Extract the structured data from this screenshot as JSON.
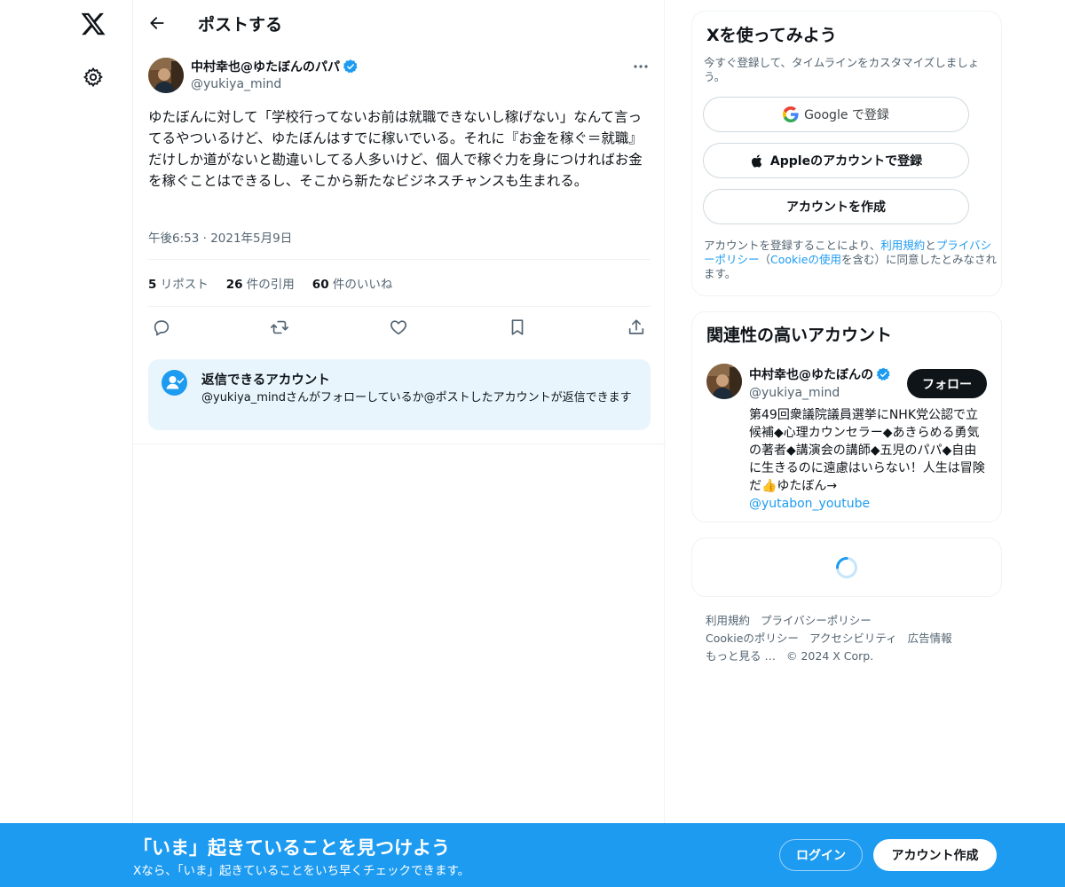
{
  "nav": {
    "logo_icon": "x-logo-icon",
    "settings_icon": "gear-icon"
  },
  "header": {
    "title": "ポストする"
  },
  "tweet": {
    "author_name": "中村幸也@ゆたぼんのパパ",
    "author_handle": "@yukiya_mind",
    "text": "ゆたぼんに対して「学校行ってないお前は就職できないし稼げない」なんて言ってるやついるけど、ゆたぼんはすでに稼いでいる。それに『お金を稼ぐ＝就職』だけしか道がないと勘違いしてる人多いけど、個人で稼ぐ力を身につければお金を稼ぐことはできるし、そこから新たなビジネスチャンスも生まれる。",
    "time": "午後6:53 · 2021年5月9日",
    "stats": {
      "reposts_count": "5",
      "reposts_label": "リポスト",
      "quotes_count": "26",
      "quotes_label": "件の引用",
      "likes_count": "60",
      "likes_label": "件のいいね"
    }
  },
  "reply_restriction": {
    "title": "返信できるアカウント",
    "description": "@yukiya_mindさんがフォローしているか@ポストしたアカウントが返信できます"
  },
  "signup": {
    "title": "Xを使ってみよう",
    "subtitle": "今すぐ登録して、タイムラインをカスタマイズしましょう。",
    "google_label": "Google で登録",
    "apple_label": "Appleのアカウントで登録",
    "create_label": "アカウントを作成",
    "terms_pre": "アカウントを登録することにより、",
    "terms_link1": "利用規約",
    "terms_mid1": "と",
    "terms_link2": "プライバシーポリシー",
    "terms_mid2": "（",
    "terms_link3": "Cookieの使用",
    "terms_post": "を含む）に同意したとみなされます。"
  },
  "related": {
    "title": "関連性の高いアカウント",
    "name": "中村幸也@ゆたぼんのパパ",
    "handle": "@yukiya_mind",
    "follow_label": "フォロー",
    "bio": "第49回衆議院議員選挙にNHK党公認で立候補◆心理カウンセラー◆あきらめる勇気の著者◆講演会の講師◆五児のパパ◆自由に生きるのに遠慮はいらない！人生は冒険だ👍ゆたぼん→",
    "bio_link": "@yutabon_youtube"
  },
  "footer": {
    "links": [
      "利用規約",
      "プライバシーポリシー",
      "Cookieのポリシー",
      "アクセシビリティ",
      "広告情報",
      "もっと見る …"
    ],
    "copyright": "© 2024 X Corp."
  },
  "banner": {
    "title": "「いま」起きていることを見つけよう",
    "subtitle": "Xなら、「いま」起きていることをいち早くチェックできます。",
    "login_label": "ログイン",
    "create_label": "アカウント作成"
  },
  "colors": {
    "accent": "#1d9bf0",
    "text": "#0f1419",
    "muted": "#536471"
  }
}
